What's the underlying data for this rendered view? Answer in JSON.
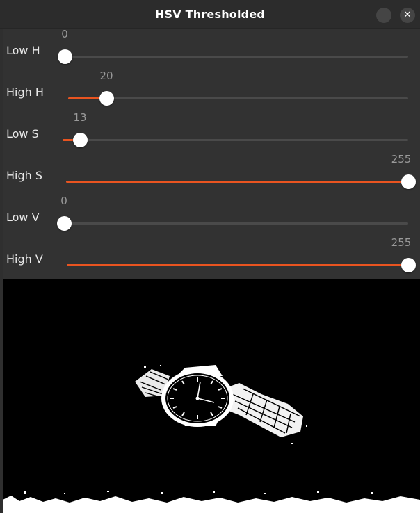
{
  "window": {
    "title": "HSV Thresholded",
    "minimize_icon": "minimize-icon",
    "close_icon": "close-icon",
    "minimize_glyph": "–",
    "close_glyph": "✕"
  },
  "sliders": [
    {
      "label": "Low H",
      "value": "0",
      "fraction": 0.0
    },
    {
      "label": "High H",
      "value": "20",
      "fraction": 0.113
    },
    {
      "label": "Low S",
      "value": "13",
      "fraction": 0.051
    },
    {
      "label": "High S",
      "value": "255",
      "fraction": 1.0
    },
    {
      "label": "Low V",
      "value": "0",
      "fraction": 0.0
    },
    {
      "label": "High V",
      "value": "255",
      "fraction": 1.0
    }
  ],
  "colors": {
    "accent": "#e95420",
    "track": "#4a4a4a",
    "knob": "#ffffff"
  },
  "image": {
    "content": "thresholded-mask-of-wristwatch"
  }
}
